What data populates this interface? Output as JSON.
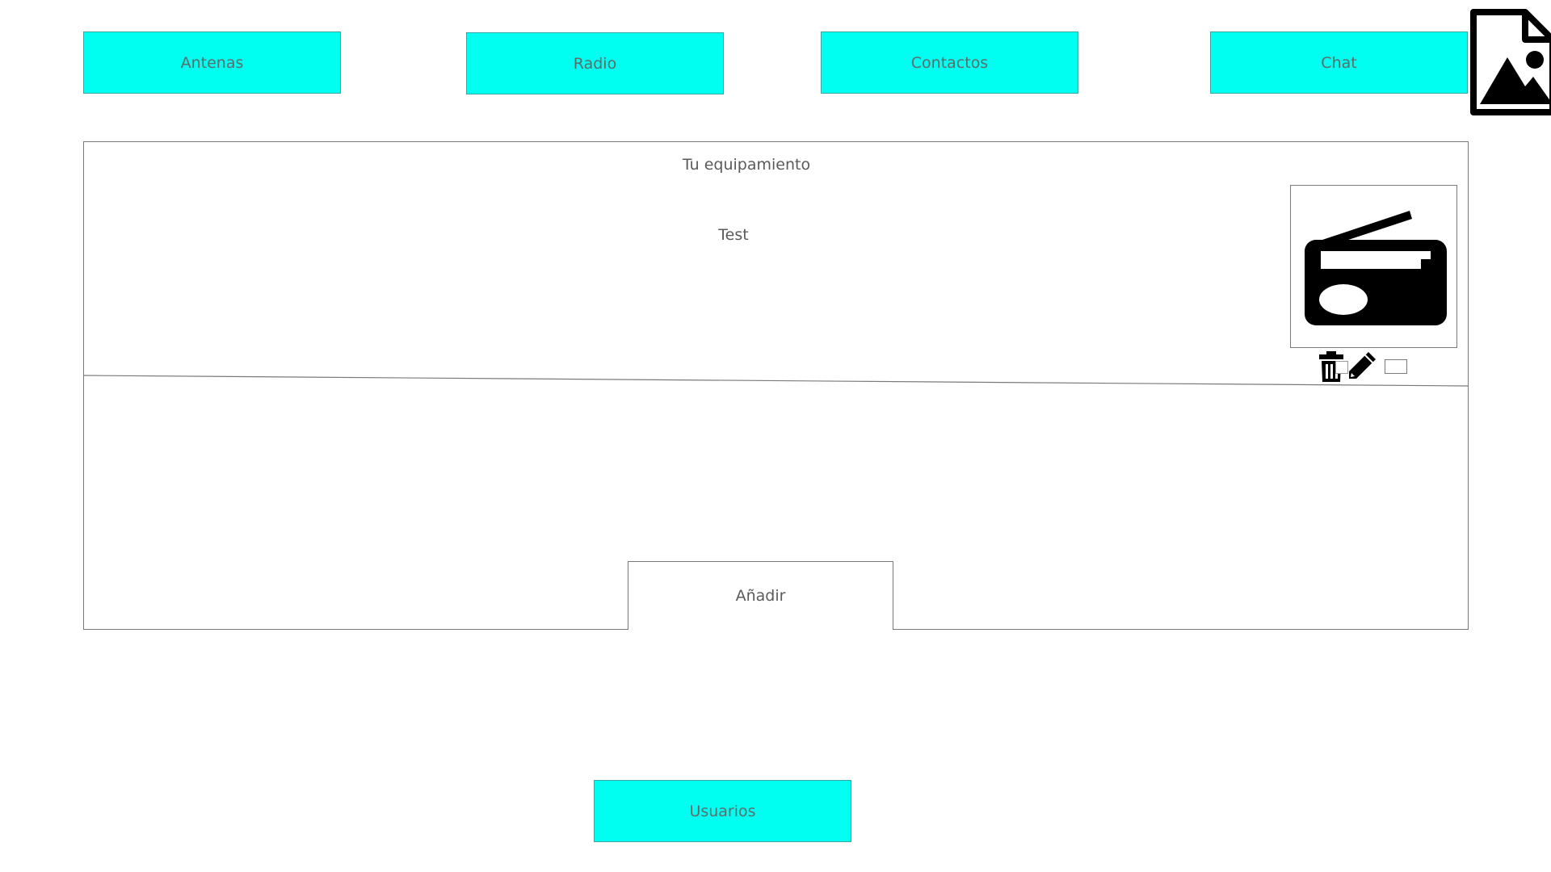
{
  "nav": {
    "antenas": "Antenas",
    "radio": "Radio",
    "contactos": "Contactos",
    "chat": "Chat",
    "usuarios": "Usuarios"
  },
  "panel": {
    "title": "Tu equipamiento",
    "item_name": "Test",
    "item_icon": "radio-icon",
    "add_label": "Añadir"
  },
  "icons": {
    "broken_image": "broken-image-icon",
    "delete": "trash-icon",
    "edit": "pencil-icon"
  },
  "colors": {
    "nav_button_bg": "#00fff0",
    "text": "#5a5a5a"
  }
}
